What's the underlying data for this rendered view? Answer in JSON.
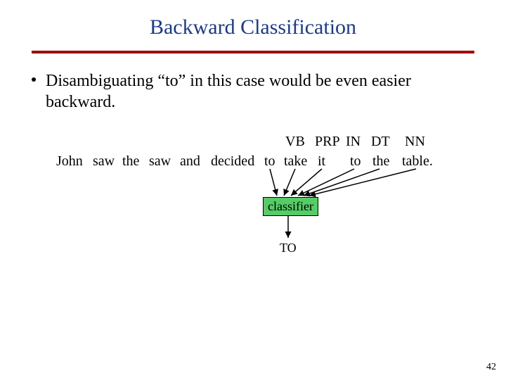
{
  "title": "Backward Classification",
  "bullet": "Disambiguating “to” in this case would be even easier backward.",
  "pos": {
    "vb": "VB",
    "prp": "PRP",
    "in": "IN",
    "dt": "DT",
    "nn": "NN"
  },
  "sentence": {
    "w0": "John",
    "w1": "saw",
    "w2": "the",
    "w3": "saw",
    "w4": "and",
    "w5": "decided",
    "w6": "to",
    "w7": "take",
    "w8": "it",
    "w9": "to",
    "w10": "the",
    "w11": "table."
  },
  "classifier": "classifier",
  "output": "TO",
  "page": "42"
}
